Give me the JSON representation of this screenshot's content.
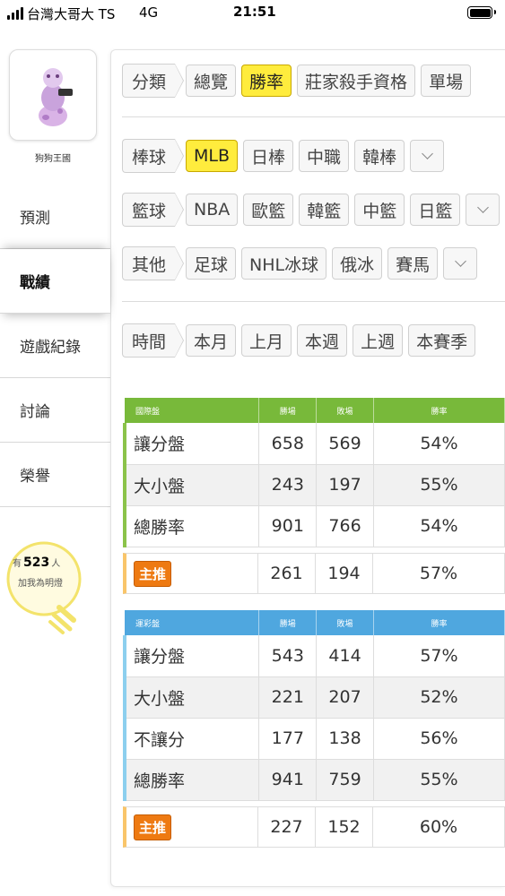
{
  "status": {
    "carrier": "台灣大哥大 TS",
    "network": "4G",
    "time": "21:51"
  },
  "profile": {
    "username": "狗狗王國"
  },
  "sidebar": {
    "items": [
      {
        "label": "預測"
      },
      {
        "label": "戰績"
      },
      {
        "label": "遊戲紀錄"
      },
      {
        "label": "討論"
      },
      {
        "label": "榮譽"
      }
    ],
    "active": "戰績"
  },
  "lightbulb": {
    "prefix": "有",
    "count": "523",
    "suffix": "人",
    "line2": "加我為明燈"
  },
  "filters": {
    "category": {
      "label": "分類",
      "chips": [
        "總覽",
        "勝率",
        "莊家殺手資格",
        "單場"
      ],
      "selected": "勝率"
    },
    "baseball": {
      "label": "棒球",
      "chips": [
        "MLB",
        "日棒",
        "中職",
        "韓棒"
      ],
      "selected": "MLB"
    },
    "basketball": {
      "label": "籃球",
      "chips": [
        "NBA",
        "歐籃",
        "韓籃",
        "中籃",
        "日籃"
      ]
    },
    "other": {
      "label": "其他",
      "chips": [
        "足球",
        "NHL冰球",
        "俄冰",
        "賽馬"
      ]
    },
    "time": {
      "label": "時間",
      "chips": [
        "本月",
        "上月",
        "本週",
        "上週",
        "本賽季"
      ]
    }
  },
  "tables": {
    "intl": {
      "headers": [
        "國際盤",
        "勝場",
        "敗場",
        "勝率"
      ],
      "rows": [
        {
          "name": "讓分盤",
          "win": "658",
          "loss": "569",
          "rate": "54%"
        },
        {
          "name": "大小盤",
          "win": "243",
          "loss": "197",
          "rate": "55%"
        },
        {
          "name": "總勝率",
          "win": "901",
          "loss": "766",
          "rate": "54%"
        }
      ],
      "pick": {
        "badge": "主推",
        "win": "261",
        "loss": "194",
        "rate": "57%"
      }
    },
    "lottery": {
      "headers": [
        "運彩盤",
        "勝場",
        "敗場",
        "勝率"
      ],
      "rows": [
        {
          "name": "讓分盤",
          "win": "543",
          "loss": "414",
          "rate": "57%"
        },
        {
          "name": "大小盤",
          "win": "221",
          "loss": "207",
          "rate": "52%"
        },
        {
          "name": "不讓分",
          "win": "177",
          "loss": "138",
          "rate": "56%"
        },
        {
          "name": "總勝率",
          "win": "941",
          "loss": "759",
          "rate": "55%"
        }
      ],
      "pick": {
        "badge": "主推",
        "win": "227",
        "loss": "152",
        "rate": "60%"
      }
    }
  },
  "colors": {
    "intl_header": "#78b93a",
    "lottery_header": "#4fa7df",
    "selected_chip": "#ffec3d",
    "pick_badge": "#ee7a12"
  }
}
